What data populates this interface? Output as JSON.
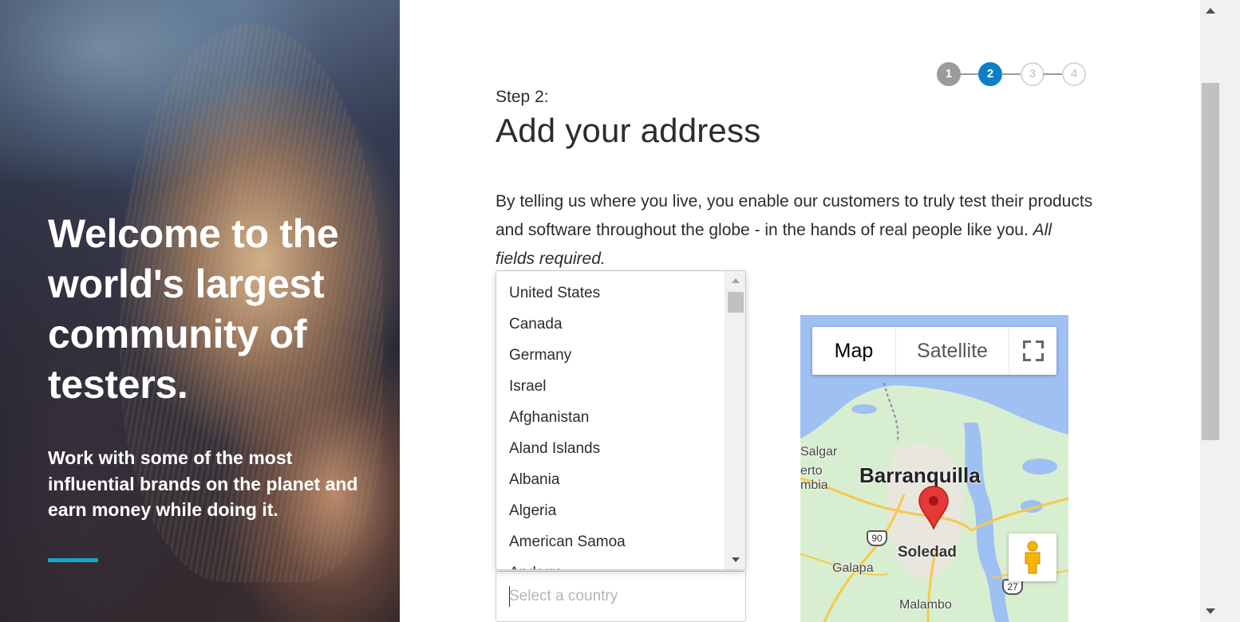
{
  "hero": {
    "title": "Welcome to the world's largest community of testers.",
    "subtitle": "Work with some of the most influential brands on the planet and earn money while doing it.",
    "accent_color": "#1aa5c6"
  },
  "stepper": {
    "steps": [
      {
        "number": "1",
        "state": "done"
      },
      {
        "number": "2",
        "state": "active"
      },
      {
        "number": "3",
        "state": "todo"
      },
      {
        "number": "4",
        "state": "todo"
      }
    ],
    "active_color": "#0e7fc7",
    "done_color": "#9b9b9b"
  },
  "form": {
    "step_label": "Step 2:",
    "title": "Add your address",
    "intro": "By telling us where you live, you enable our customers to truly test their products and software throughout the globe - in the hands of real people like you.",
    "intro_emphasis": "All fields required.",
    "country": {
      "placeholder": "Select a country",
      "options": [
        "United States",
        "Canada",
        "Germany",
        "Israel",
        "Afghanistan",
        "Aland Islands",
        "Albania",
        "Algeria",
        "American Samoa",
        "Andorra"
      ]
    }
  },
  "map": {
    "map_button": "Map",
    "satellite_button": "Satellite",
    "fullscreen_icon": "fullscreen-icon",
    "pegman_icon": "pegman-icon",
    "marker_icon": "map-marker-icon",
    "labels": {
      "city": "Barranquilla",
      "soledad": "Soledad",
      "galapa": "Galapa",
      "malambo": "Malambo",
      "salgar": "Salgar",
      "puerto_partial": "erto",
      "colombia_partial": "mbia",
      "route_90": "90",
      "route_27": "27"
    },
    "water_color": "#9ec0f2",
    "land_color": "#d8eed0",
    "road_color": "#f7c948",
    "marker_color": "#e53935"
  }
}
